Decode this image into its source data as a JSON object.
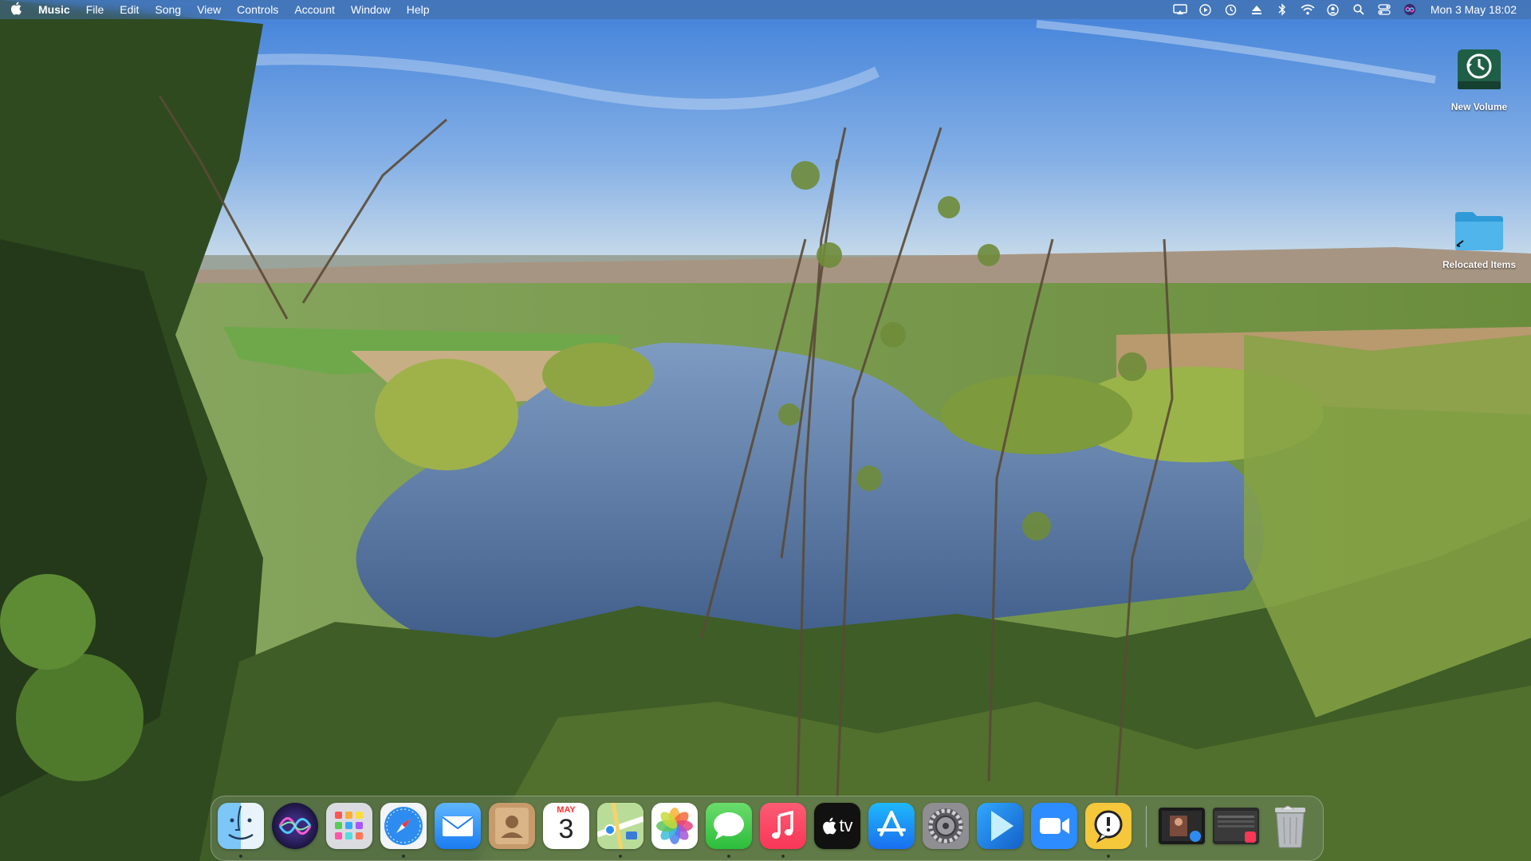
{
  "menubar": {
    "apple_icon": "apple-logo-icon",
    "app_name": "Music",
    "menus": [
      "File",
      "Edit",
      "Song",
      "View",
      "Controls",
      "Account",
      "Window",
      "Help"
    ],
    "status_icons": [
      "screen-mirroring-icon",
      "play-circle-icon",
      "time-machine-icon",
      "eject-icon",
      "bluetooth-icon",
      "wifi-icon",
      "user-account-icon",
      "spotlight-search-icon",
      "control-center-icon",
      "siri-icon"
    ],
    "clock": "Mon 3 May  18:02"
  },
  "desktop": {
    "icons": [
      {
        "label": "New Volume",
        "icon": "time-machine-drive-icon"
      },
      {
        "label": "Relocated Items",
        "icon": "folder-icon"
      }
    ]
  },
  "dock": {
    "apps": [
      {
        "name": "Finder",
        "icon": "finder-icon",
        "running": true
      },
      {
        "name": "Siri",
        "icon": "siri-icon",
        "running": false
      },
      {
        "name": "Launchpad",
        "icon": "launchpad-icon",
        "running": false
      },
      {
        "name": "Safari",
        "icon": "safari-icon",
        "running": true
      },
      {
        "name": "Mail",
        "icon": "mail-icon",
        "running": false
      },
      {
        "name": "Contacts",
        "icon": "contacts-icon",
        "running": false
      },
      {
        "name": "Calendar",
        "icon": "calendar-icon",
        "running": false,
        "month": "MAY",
        "day": "3"
      },
      {
        "name": "Maps",
        "icon": "maps-icon",
        "running": true
      },
      {
        "name": "Photos",
        "icon": "photos-icon",
        "running": false
      },
      {
        "name": "Messages",
        "icon": "messages-icon",
        "running": true
      },
      {
        "name": "Music",
        "icon": "music-icon",
        "running": true
      },
      {
        "name": "TV",
        "icon": "apple-tv-icon",
        "running": false,
        "label": "tv"
      },
      {
        "name": "App Store",
        "icon": "app-store-icon",
        "running": false
      },
      {
        "name": "System Preferences",
        "icon": "system-preferences-icon",
        "running": false
      },
      {
        "name": "Prime Video",
        "icon": "prime-video-icon",
        "running": false
      },
      {
        "name": "Zoom",
        "icon": "zoom-icon",
        "running": false
      },
      {
        "name": "Console",
        "icon": "console-icon",
        "running": false
      }
    ],
    "stacks": [
      {
        "name": "Recent Item 1",
        "icon": "recent-window-thumbnail-icon"
      },
      {
        "name": "Recent Item 2",
        "icon": "recent-window-thumbnail-icon"
      },
      {
        "name": "Trash",
        "icon": "trash-icon"
      }
    ]
  },
  "colors": {
    "sky": "#5a8ed8",
    "water": "#5b7fae",
    "foliage": "#3d5a25"
  }
}
